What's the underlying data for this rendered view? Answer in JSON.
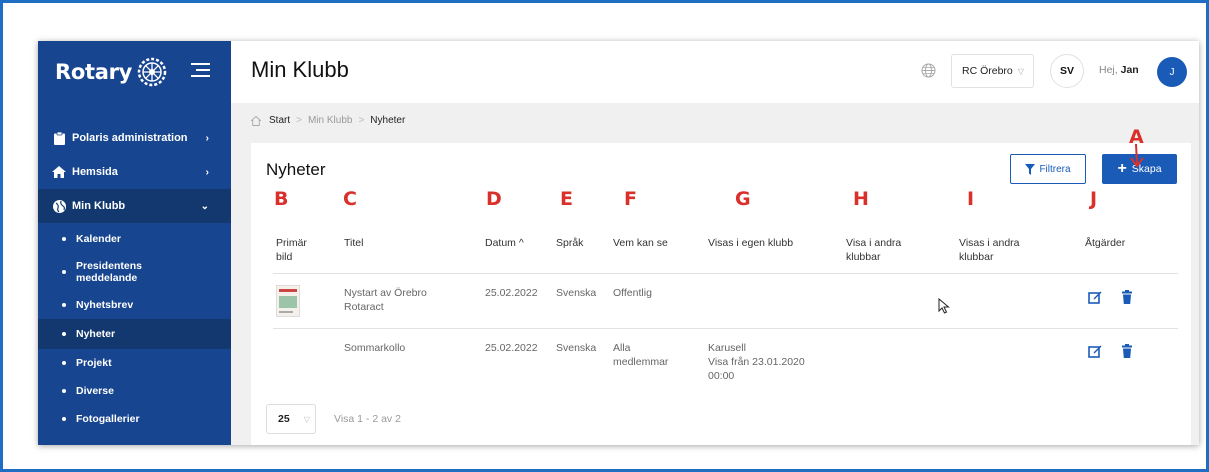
{
  "sidebar": {
    "brand": "Rotary",
    "items": [
      {
        "label": "Polaris administration",
        "icon": "clipboard-icon"
      },
      {
        "label": "Hemsida",
        "icon": "home-icon"
      },
      {
        "label": "Min Klubb",
        "icon": "globe-icon"
      }
    ],
    "sub_items": [
      {
        "label": "Kalender"
      },
      {
        "label": "Presidentens meddelande"
      },
      {
        "label": "Nyhetsbrev"
      },
      {
        "label": "Nyheter"
      },
      {
        "label": "Projekt"
      },
      {
        "label": "Diverse"
      },
      {
        "label": "Fotogallerier"
      }
    ]
  },
  "header": {
    "title": "Min Klubb",
    "club": "RC Örebro",
    "language": "SV",
    "greeting": "Hej,",
    "user": "Jan",
    "avatar_initial": "J"
  },
  "breadcrumb": [
    "Start",
    "Min Klubb",
    "Nyheter"
  ],
  "card": {
    "title": "Nyheter",
    "filter_label": "Filtrera",
    "create_label": "Skapa"
  },
  "annotations": [
    "A",
    "B",
    "C",
    "D",
    "E",
    "F",
    "G",
    "H",
    "I",
    "J"
  ],
  "table": {
    "headers": {
      "image": "Primär bild",
      "title": "Titel",
      "date": "Datum ^",
      "language": "Språk",
      "visibility": "Vem kan se",
      "own_club": "Visas i egen klubb",
      "other_clubs": "Visa i andra klubbar",
      "shown_other": "Visas i andra klubbar",
      "actions": "Åtgärder"
    },
    "rows": [
      {
        "title": "Nystart av Örebro Rotaract",
        "date": "25.02.2022",
        "language": "Svenska",
        "visibility": "Offentlig",
        "own_club": ""
      },
      {
        "title": "Sommarkollo",
        "date": "25.02.2022",
        "language": "Svenska",
        "visibility": "Alla medlemmar",
        "own_club": "Karusell\nVisa från 23.01.2020 00:00"
      }
    ]
  },
  "pagination": {
    "page_size": "25",
    "info": "Visa 1 - 2 av 2"
  },
  "colors": {
    "sidebar": "#17458f",
    "accent": "#1a5bb8",
    "annotation": "#d9302b"
  }
}
